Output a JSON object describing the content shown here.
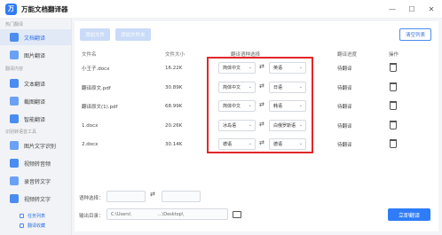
{
  "app": {
    "title": "万能文档翻译器",
    "logo_glyph": "万"
  },
  "window_controls": [
    "—",
    "☐",
    "✕"
  ],
  "sidebar": {
    "sections": [
      "热门翻译",
      "翻译内容",
      "识别转语音工具"
    ],
    "items": [
      {
        "label": "文档翻译",
        "icon": "document-icon",
        "active": true
      },
      {
        "label": "图片翻译",
        "icon": "image-icon"
      },
      {
        "label": "文本翻译",
        "icon": "text-icon"
      },
      {
        "label": "截图翻译",
        "icon": "screenshot-icon"
      },
      {
        "label": "智能翻译",
        "icon": "ai-icon"
      },
      {
        "label": "图片文字识别",
        "icon": "ocr-icon"
      },
      {
        "label": "视频转音频",
        "icon": "video-icon"
      },
      {
        "label": "录音转文字",
        "icon": "record-icon"
      },
      {
        "label": "视频转文字",
        "icon": "video-text-icon"
      }
    ],
    "bottom_links": [
      "任务列表",
      "翻译收藏"
    ]
  },
  "toolbar": {
    "add_file": "添加文件",
    "add_folder": "添加文件夹",
    "clear_list": "清空列表"
  },
  "table": {
    "headers": [
      "文件名",
      "文件大小",
      "翻译语种选择",
      "翻译进度",
      "操作"
    ],
    "rows": [
      {
        "name": "小王子.docx",
        "size": "16.22K",
        "from": "简体中文",
        "to": "英语",
        "status": "待翻译"
      },
      {
        "name": "翻译原文.pdf",
        "size": "30.89K",
        "from": "简体中文",
        "to": "日语",
        "status": "待翻译"
      },
      {
        "name": "翻译原文(1).pdf",
        "size": "68.99K",
        "from": "简体中文",
        "to": "韩语",
        "status": "待翻译"
      },
      {
        "name": "1.docx",
        "size": "20.26K",
        "from": "冰岛语",
        "to": "白俄罗斯语",
        "status": "待翻译"
      },
      {
        "name": "2.docx",
        "size": "30.14K",
        "from": "德语",
        "to": "德语",
        "status": "待翻译"
      }
    ]
  },
  "footer": {
    "lang_label": "语种选择：",
    "lang_from": "",
    "lang_to": "",
    "output_label": "输出目录：",
    "output_path": "C:\\Users\\",
    "output_path_end": "…\\Desktop\\",
    "start": "立即翻译"
  },
  "colors": {
    "accent": "#2f7cf6",
    "highlight_box": "#e3262a"
  }
}
